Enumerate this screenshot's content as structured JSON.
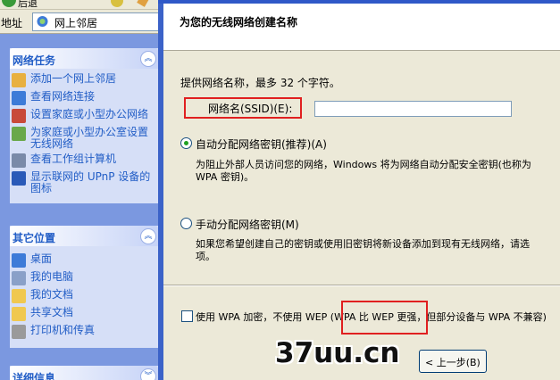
{
  "toolbar": {
    "back_text": "后退"
  },
  "address": {
    "label": "地址",
    "value": "网上邻居",
    "icon": "network-places-icon"
  },
  "network_tasks": {
    "title": "网络任务",
    "items": [
      {
        "label": "添加一个网上邻居",
        "icon": "add-network-place-icon"
      },
      {
        "label": "查看网络连接",
        "icon": "network-connections-icon"
      },
      {
        "label": "设置家庭或小型办公网络",
        "icon": "home-network-icon"
      },
      {
        "label": "为家庭或小型办公室设置无线网络",
        "icon": "wireless-network-icon"
      },
      {
        "label": "查看工作组计算机",
        "icon": "workgroup-icon"
      },
      {
        "label": "显示联网的 UPnP 设备的图标",
        "icon": "upnp-icon"
      }
    ]
  },
  "other_places": {
    "title": "其它位置",
    "items": [
      {
        "label": "桌面",
        "icon": "desktop-icon"
      },
      {
        "label": "我的电脑",
        "icon": "my-computer-icon"
      },
      {
        "label": "我的文档",
        "icon": "my-documents-icon"
      },
      {
        "label": "共享文档",
        "icon": "shared-documents-icon"
      },
      {
        "label": "打印机和传真",
        "icon": "printer-icon"
      }
    ]
  },
  "details": {
    "title": "详细信息"
  },
  "wizard": {
    "heading": "为您的无线网络创建名称",
    "instruction": "提供网络名称，最多 32 个字符。",
    "ssid_label": "网络名(SSID)(E):",
    "ssid_value": "",
    "auto_option": "自动分配网络密钥(推荐)(A)",
    "auto_desc_1": "为阻止外部人员访问您的网络，Windows 将为网络自动分配安全密钥(也称为",
    "auto_desc_2": "WPA 密钥)。",
    "manual_option": "手动分配网络密钥(M)",
    "manual_desc_1": "如果您希望创建自己的密钥或使用旧密钥将新设备添加到现有无线网络，请选",
    "manual_desc_2": "项。",
    "wep_checkbox": "使用 WPA 加密，不使用 WEP (WPA 比 WEP 更强，但部分设备与 WPA 不兼容)",
    "back_button": "< 上一步(B)"
  },
  "watermark": {
    "text": "37uu.cn"
  }
}
